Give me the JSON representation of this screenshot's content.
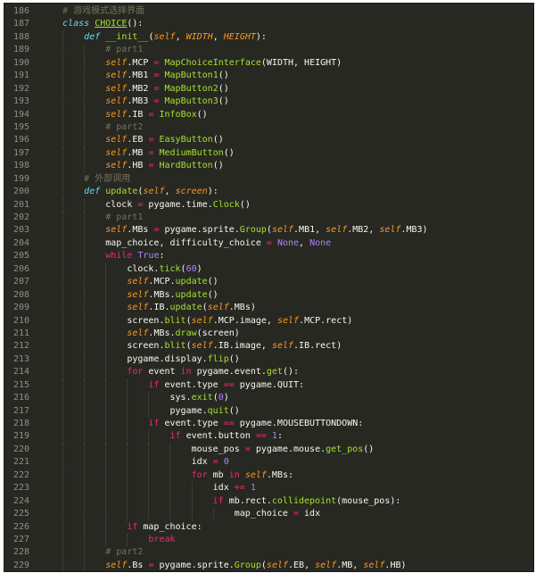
{
  "editor": {
    "lines": [
      {
        "n": "186",
        "indent": 1,
        "tokens": [
          [
            "cm",
            "# 游戏模式选择界面"
          ]
        ]
      },
      {
        "n": "187",
        "indent": 1,
        "tokens": [
          [
            "st",
            "class"
          ],
          [
            "p",
            " "
          ],
          [
            "cls",
            "CHOICE"
          ],
          [
            "p",
            "():"
          ]
        ]
      },
      {
        "n": "188",
        "indent": 2,
        "tokens": [
          [
            "st",
            "def"
          ],
          [
            "p",
            " "
          ],
          [
            "fn",
            "__init__"
          ],
          [
            "p",
            "("
          ],
          [
            "self",
            "self"
          ],
          [
            "p",
            ", "
          ],
          [
            "param",
            "WIDTH"
          ],
          [
            "p",
            ", "
          ],
          [
            "param",
            "HEIGHT"
          ],
          [
            "p",
            "):"
          ]
        ]
      },
      {
        "n": "189",
        "indent": 3,
        "tokens": [
          [
            "cm",
            "# part1"
          ]
        ]
      },
      {
        "n": "190",
        "indent": 3,
        "tokens": [
          [
            "self",
            "self"
          ],
          [
            "p",
            ".MCP "
          ],
          [
            "op",
            "="
          ],
          [
            "p",
            " "
          ],
          [
            "fn",
            "MapChoiceInterface"
          ],
          [
            "p",
            "(WIDTH, HEIGHT)"
          ]
        ]
      },
      {
        "n": "191",
        "indent": 3,
        "tokens": [
          [
            "self",
            "self"
          ],
          [
            "p",
            ".MB1 "
          ],
          [
            "op",
            "="
          ],
          [
            "p",
            " "
          ],
          [
            "fn",
            "MapButton1"
          ],
          [
            "p",
            "()"
          ]
        ]
      },
      {
        "n": "192",
        "indent": 3,
        "tokens": [
          [
            "self",
            "self"
          ],
          [
            "p",
            ".MB2 "
          ],
          [
            "op",
            "="
          ],
          [
            "p",
            " "
          ],
          [
            "fn",
            "MapButton2"
          ],
          [
            "p",
            "()"
          ]
        ]
      },
      {
        "n": "193",
        "indent": 3,
        "tokens": [
          [
            "self",
            "self"
          ],
          [
            "p",
            ".MB3 "
          ],
          [
            "op",
            "="
          ],
          [
            "p",
            " "
          ],
          [
            "fn",
            "MapButton3"
          ],
          [
            "p",
            "()"
          ]
        ]
      },
      {
        "n": "194",
        "indent": 3,
        "tokens": [
          [
            "self",
            "self"
          ],
          [
            "p",
            ".IB "
          ],
          [
            "op",
            "="
          ],
          [
            "p",
            " "
          ],
          [
            "fn",
            "InfoBox"
          ],
          [
            "p",
            "()"
          ]
        ]
      },
      {
        "n": "195",
        "indent": 3,
        "tokens": [
          [
            "cm",
            "# part2"
          ]
        ]
      },
      {
        "n": "196",
        "indent": 3,
        "tokens": [
          [
            "self",
            "self"
          ],
          [
            "p",
            ".EB "
          ],
          [
            "op",
            "="
          ],
          [
            "p",
            " "
          ],
          [
            "fn",
            "EasyButton"
          ],
          [
            "p",
            "()"
          ]
        ]
      },
      {
        "n": "197",
        "indent": 3,
        "tokens": [
          [
            "self",
            "self"
          ],
          [
            "p",
            ".MB "
          ],
          [
            "op",
            "="
          ],
          [
            "p",
            " "
          ],
          [
            "fn",
            "MediumButton"
          ],
          [
            "p",
            "()"
          ]
        ]
      },
      {
        "n": "198",
        "indent": 3,
        "tokens": [
          [
            "self",
            "self"
          ],
          [
            "p",
            ".HB "
          ],
          [
            "op",
            "="
          ],
          [
            "p",
            " "
          ],
          [
            "fn",
            "HardButton"
          ],
          [
            "p",
            "()"
          ]
        ]
      },
      {
        "n": "199",
        "indent": 2,
        "tokens": [
          [
            "cm",
            "# 外部调用"
          ]
        ]
      },
      {
        "n": "200",
        "indent": 2,
        "tokens": [
          [
            "st",
            "def"
          ],
          [
            "p",
            " "
          ],
          [
            "fn",
            "update"
          ],
          [
            "p",
            "("
          ],
          [
            "self",
            "self"
          ],
          [
            "p",
            ", "
          ],
          [
            "param",
            "screen"
          ],
          [
            "p",
            "):"
          ]
        ]
      },
      {
        "n": "201",
        "indent": 3,
        "tokens": [
          [
            "p",
            "clock "
          ],
          [
            "op",
            "="
          ],
          [
            "p",
            " pygame.time."
          ],
          [
            "fn",
            "Clock"
          ],
          [
            "p",
            "()"
          ]
        ]
      },
      {
        "n": "202",
        "indent": 3,
        "tokens": [
          [
            "cm",
            "# part1"
          ]
        ]
      },
      {
        "n": "203",
        "indent": 3,
        "tokens": [
          [
            "self",
            "self"
          ],
          [
            "p",
            ".MBs "
          ],
          [
            "op",
            "="
          ],
          [
            "p",
            " pygame.sprite."
          ],
          [
            "fn",
            "Group"
          ],
          [
            "p",
            "("
          ],
          [
            "self",
            "self"
          ],
          [
            "p",
            ".MB1, "
          ],
          [
            "self",
            "self"
          ],
          [
            "p",
            ".MB2, "
          ],
          [
            "self",
            "self"
          ],
          [
            "p",
            ".MB3)"
          ]
        ]
      },
      {
        "n": "204",
        "indent": 3,
        "tokens": [
          [
            "p",
            "map_choice, difficulty_choice "
          ],
          [
            "op",
            "="
          ],
          [
            "p",
            " "
          ],
          [
            "const",
            "None"
          ],
          [
            "p",
            ", "
          ],
          [
            "const",
            "None"
          ]
        ]
      },
      {
        "n": "205",
        "indent": 3,
        "tokens": [
          [
            "kw",
            "while"
          ],
          [
            "p",
            " "
          ],
          [
            "const",
            "True"
          ],
          [
            "p",
            ":"
          ]
        ]
      },
      {
        "n": "206",
        "indent": 4,
        "tokens": [
          [
            "p",
            "clock."
          ],
          [
            "fn",
            "tick"
          ],
          [
            "p",
            "("
          ],
          [
            "num",
            "60"
          ],
          [
            "p",
            ")"
          ]
        ]
      },
      {
        "n": "207",
        "indent": 4,
        "tokens": [
          [
            "self",
            "self"
          ],
          [
            "p",
            ".MCP."
          ],
          [
            "fn",
            "update"
          ],
          [
            "p",
            "()"
          ]
        ]
      },
      {
        "n": "208",
        "indent": 4,
        "tokens": [
          [
            "self",
            "self"
          ],
          [
            "p",
            ".MBs."
          ],
          [
            "fn",
            "update"
          ],
          [
            "p",
            "()"
          ]
        ]
      },
      {
        "n": "209",
        "indent": 4,
        "tokens": [
          [
            "self",
            "self"
          ],
          [
            "p",
            ".IB."
          ],
          [
            "fn",
            "update"
          ],
          [
            "p",
            "("
          ],
          [
            "self",
            "self"
          ],
          [
            "p",
            ".MBs)"
          ]
        ]
      },
      {
        "n": "210",
        "indent": 4,
        "tokens": [
          [
            "p",
            "screen."
          ],
          [
            "fn",
            "blit"
          ],
          [
            "p",
            "("
          ],
          [
            "self",
            "self"
          ],
          [
            "p",
            ".MCP.image, "
          ],
          [
            "self",
            "self"
          ],
          [
            "p",
            ".MCP.rect)"
          ]
        ]
      },
      {
        "n": "211",
        "indent": 4,
        "tokens": [
          [
            "self",
            "self"
          ],
          [
            "p",
            ".MBs."
          ],
          [
            "fn",
            "draw"
          ],
          [
            "p",
            "(screen)"
          ]
        ]
      },
      {
        "n": "212",
        "indent": 4,
        "tokens": [
          [
            "p",
            "screen."
          ],
          [
            "fn",
            "blit"
          ],
          [
            "p",
            "("
          ],
          [
            "self",
            "self"
          ],
          [
            "p",
            ".IB.image, "
          ],
          [
            "self",
            "self"
          ],
          [
            "p",
            ".IB.rect)"
          ]
        ]
      },
      {
        "n": "213",
        "indent": 4,
        "tokens": [
          [
            "p",
            "pygame.display."
          ],
          [
            "fn",
            "flip"
          ],
          [
            "p",
            "()"
          ]
        ]
      },
      {
        "n": "214",
        "indent": 4,
        "tokens": [
          [
            "kw",
            "for"
          ],
          [
            "p",
            " event "
          ],
          [
            "kw",
            "in"
          ],
          [
            "p",
            " pygame.event."
          ],
          [
            "fn",
            "get"
          ],
          [
            "p",
            "():"
          ]
        ]
      },
      {
        "n": "215",
        "indent": 5,
        "tokens": [
          [
            "kw",
            "if"
          ],
          [
            "p",
            " event.type "
          ],
          [
            "op",
            "=="
          ],
          [
            "p",
            " pygame.QUIT:"
          ]
        ]
      },
      {
        "n": "216",
        "indent": 6,
        "tokens": [
          [
            "p",
            "sys."
          ],
          [
            "fn",
            "exit"
          ],
          [
            "p",
            "("
          ],
          [
            "num",
            "0"
          ],
          [
            "p",
            ")"
          ]
        ]
      },
      {
        "n": "217",
        "indent": 6,
        "tokens": [
          [
            "p",
            "pygame."
          ],
          [
            "fn",
            "quit"
          ],
          [
            "p",
            "()"
          ]
        ]
      },
      {
        "n": "218",
        "indent": 5,
        "tokens": [
          [
            "kw",
            "if"
          ],
          [
            "p",
            " event.type "
          ],
          [
            "op",
            "=="
          ],
          [
            "p",
            " pygame.MOUSEBUTTONDOWN:"
          ]
        ]
      },
      {
        "n": "219",
        "indent": 6,
        "tokens": [
          [
            "kw",
            "if"
          ],
          [
            "p",
            " event.button "
          ],
          [
            "op",
            "=="
          ],
          [
            "p",
            " "
          ],
          [
            "num",
            "1"
          ],
          [
            "p",
            ":"
          ]
        ]
      },
      {
        "n": "220",
        "indent": 7,
        "tokens": [
          [
            "p",
            "mouse_pos "
          ],
          [
            "op",
            "="
          ],
          [
            "p",
            " pygame.mouse."
          ],
          [
            "fn",
            "get_pos"
          ],
          [
            "p",
            "()"
          ]
        ]
      },
      {
        "n": "221",
        "indent": 7,
        "tokens": [
          [
            "p",
            "idx "
          ],
          [
            "op",
            "="
          ],
          [
            "p",
            " "
          ],
          [
            "num",
            "0"
          ]
        ]
      },
      {
        "n": "222",
        "indent": 7,
        "tokens": [
          [
            "kw",
            "for"
          ],
          [
            "p",
            " mb "
          ],
          [
            "kw",
            "in"
          ],
          [
            "p",
            " "
          ],
          [
            "self",
            "self"
          ],
          [
            "p",
            ".MBs:"
          ]
        ]
      },
      {
        "n": "223",
        "indent": 8,
        "tokens": [
          [
            "p",
            "idx "
          ],
          [
            "op",
            "+="
          ],
          [
            "p",
            " "
          ],
          [
            "num",
            "1"
          ]
        ]
      },
      {
        "n": "224",
        "indent": 8,
        "tokens": [
          [
            "kw",
            "if"
          ],
          [
            "p",
            " mb.rect."
          ],
          [
            "fn",
            "collidepoint"
          ],
          [
            "p",
            "(mouse_pos):"
          ]
        ]
      },
      {
        "n": "225",
        "indent": 9,
        "tokens": [
          [
            "p",
            "map_choice "
          ],
          [
            "op",
            "="
          ],
          [
            "p",
            " idx"
          ]
        ]
      },
      {
        "n": "226",
        "indent": 4,
        "tokens": [
          [
            "kw",
            "if"
          ],
          [
            "p",
            " map_choice:"
          ]
        ]
      },
      {
        "n": "227",
        "indent": 5,
        "tokens": [
          [
            "kw",
            "break"
          ]
        ]
      },
      {
        "n": "228",
        "indent": 3,
        "tokens": [
          [
            "cm",
            "# part2"
          ]
        ]
      },
      {
        "n": "229",
        "indent": 3,
        "tokens": [
          [
            "self",
            "self"
          ],
          [
            "p",
            ".Bs "
          ],
          [
            "op",
            "="
          ],
          [
            "p",
            " pygame.sprite."
          ],
          [
            "fn",
            "Group"
          ],
          [
            "p",
            "("
          ],
          [
            "self",
            "self"
          ],
          [
            "p",
            ".EB, "
          ],
          [
            "self",
            "self"
          ],
          [
            "p",
            ".MB, "
          ],
          [
            "self",
            "self"
          ],
          [
            "p",
            ".HB)"
          ]
        ]
      }
    ]
  }
}
